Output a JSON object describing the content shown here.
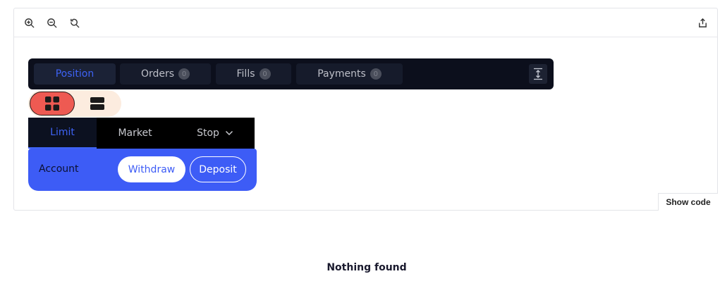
{
  "toolbar": {
    "icons": [
      "zoom-in-icon",
      "zoom-out-icon",
      "reset-zoom-icon",
      "share-icon"
    ]
  },
  "tabs": [
    {
      "label": "Position",
      "count": null,
      "active": true
    },
    {
      "label": "Orders",
      "count": "0",
      "active": false
    },
    {
      "label": "Fills",
      "count": "0",
      "active": false
    },
    {
      "label": "Payments",
      "count": "0",
      "active": false
    }
  ],
  "view_toggle": {
    "options": [
      "grid-view-icon",
      "list-view-icon"
    ],
    "active": 0
  },
  "order_types": [
    {
      "label": "Limit",
      "active": true
    },
    {
      "label": "Market",
      "active": false
    },
    {
      "label": "Stop",
      "active": false,
      "dropdown": true
    }
  ],
  "account": {
    "label": "Account",
    "withdraw_label": "Withdraw",
    "deposit_label": "Deposit"
  },
  "show_code_label": "Show code",
  "empty_message": "Nothing found",
  "colors": {
    "accent": "#3d5cf6",
    "tabbar_bg": "#0c0f1c",
    "toggle_active": "#ee5a52",
    "toggle_bg": "#fcecdf"
  }
}
